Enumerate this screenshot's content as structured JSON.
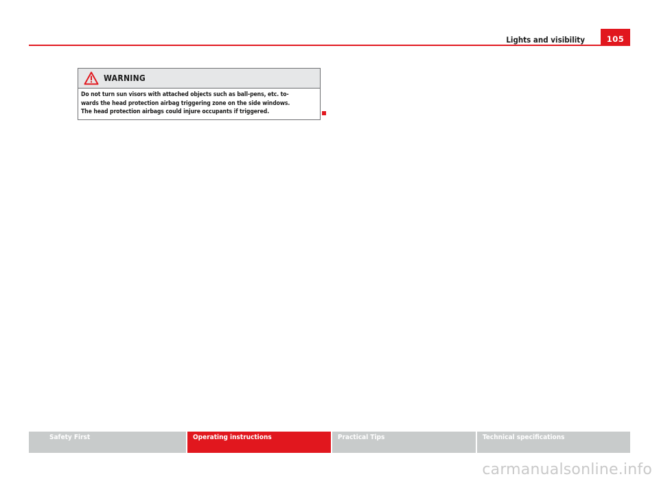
{
  "header": {
    "section_title": "Lights and visibility",
    "page_number": "105"
  },
  "warning": {
    "label": "WARNING",
    "lines": [
      "Do not turn sun visors with attached objects such as ball-pens, etc. to-",
      "wards the head protection airbag triggering zone on the side windows.",
      "The head protection airbags could injure occupants if triggered."
    ]
  },
  "footer": {
    "tabs": [
      {
        "label": "Safety First",
        "active": false
      },
      {
        "label": "Operating instructions",
        "active": true
      },
      {
        "label": "Practical Tips",
        "active": false
      },
      {
        "label": "Technical specifications",
        "active": false
      }
    ]
  },
  "watermark": {
    "text": "carmanualsonline.info"
  },
  "colors": {
    "accent": "#e1171e",
    "tab_inactive": "#c8cbcb",
    "warning_header_bg": "#e6e7e8"
  },
  "icons": {
    "warning": "warning-triangle-icon"
  }
}
